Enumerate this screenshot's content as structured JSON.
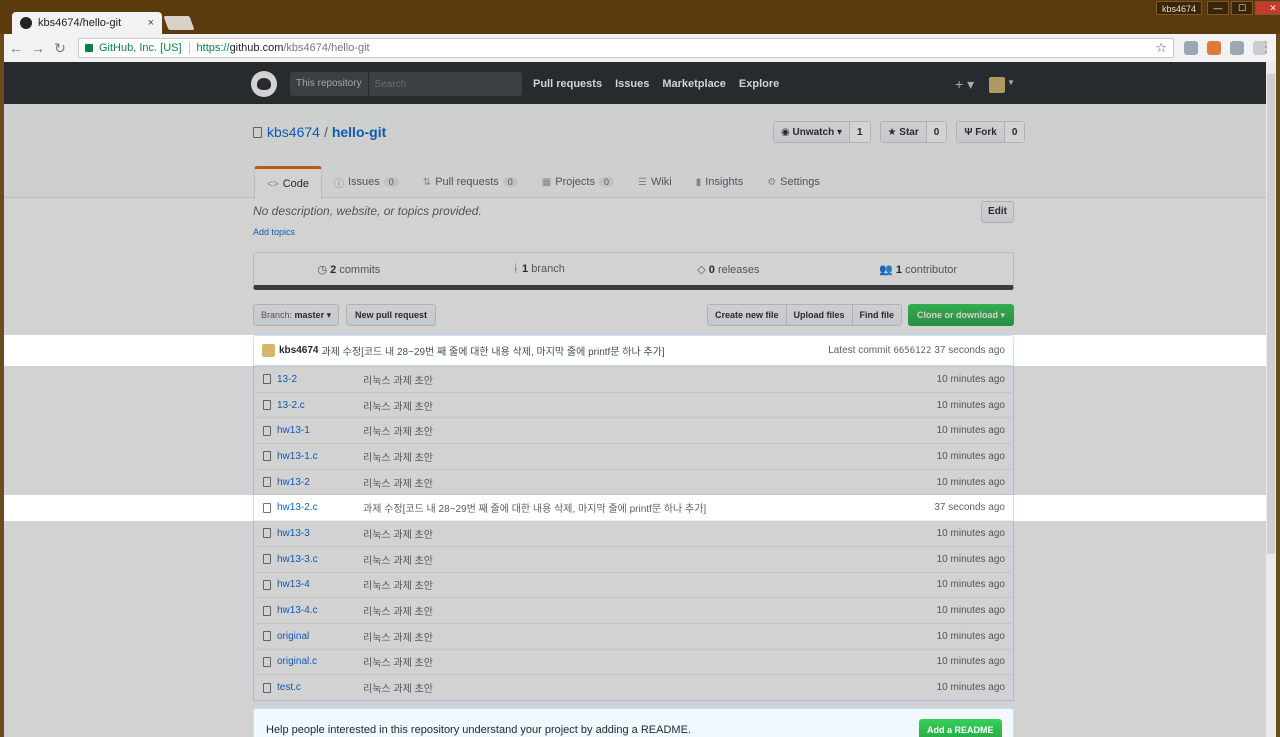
{
  "browser": {
    "tab_title": "kbs4674/hello-git",
    "tab_close": "×",
    "window_user": "kbs4674",
    "secure_label": "GitHub, Inc. [US]",
    "url_proto": "https://",
    "url_host": "github.com",
    "url_path": "/kbs4674/hello-git",
    "window_buttons": [
      "—",
      "☐",
      "✕"
    ]
  },
  "header": {
    "search_scope": "This repository",
    "search_placeholder": "Search",
    "nav": [
      "Pull requests",
      "Issues",
      "Marketplace",
      "Explore"
    ],
    "plus": "+ ▾"
  },
  "repo": {
    "owner": "kbs4674",
    "name": "hello-git",
    "watch_label": "Unwatch ▾",
    "watch_count": "1",
    "star_label": "Star",
    "star_count": "0",
    "fork_label": "Fork",
    "fork_count": "0",
    "tabs": [
      {
        "label": "Code",
        "icon": "<>",
        "count": null
      },
      {
        "label": "Issues",
        "icon": "ⓘ",
        "count": "0"
      },
      {
        "label": "Pull requests",
        "icon": "⇅",
        "count": "0"
      },
      {
        "label": "Projects",
        "icon": "▦",
        "count": "0"
      },
      {
        "label": "Wiki",
        "icon": "☰",
        "count": null
      },
      {
        "label": "Insights",
        "icon": "▮",
        "count": null
      },
      {
        "label": "Settings",
        "icon": "⚙",
        "count": null
      }
    ],
    "description": "No description, website, or topics provided.",
    "add_topics": "Add topics",
    "edit_label": "Edit"
  },
  "summary": {
    "commits_num": "2",
    "commits_label": "commits",
    "branch_num": "1",
    "branch_label": "branch",
    "releases_num": "0",
    "releases_label": "releases",
    "contrib_num": "1",
    "contrib_label": "contributor"
  },
  "filenav": {
    "branch_prefix": "Branch:",
    "branch_name": "master ▾",
    "new_pr": "New pull request",
    "create_file": "Create new file",
    "upload": "Upload files",
    "find": "Find file",
    "clone": "Clone or download ▾"
  },
  "commit": {
    "author": "kbs4674",
    "message": "과제 수정[코드 내 28~29번 째 줄에 대한 내용 삭제, 마지막 줄에 printf문 하나 추가]",
    "latest_label": "Latest commit",
    "sha": "6656122",
    "age": "37 seconds ago"
  },
  "files": [
    {
      "name": "13-2",
      "message": "리눅스 과제 초안",
      "age": "10 minutes ago"
    },
    {
      "name": "13-2.c",
      "message": "리눅스 과제 초안",
      "age": "10 minutes ago"
    },
    {
      "name": "hw13-1",
      "message": "리눅스 과제 초안",
      "age": "10 minutes ago"
    },
    {
      "name": "hw13-1.c",
      "message": "리눅스 과제 초안",
      "age": "10 minutes ago"
    },
    {
      "name": "hw13-2",
      "message": "리눅스 과제 초안",
      "age": "10 minutes ago"
    },
    {
      "name": "hw13-2.c",
      "message": "과제 수정[코드 내 28~29번 째 줄에 대한 내용 삭제, 마지막 줄에 printf문 하나 추가]",
      "age": "37 seconds ago"
    },
    {
      "name": "hw13-3",
      "message": "리눅스 과제 초안",
      "age": "10 minutes ago"
    },
    {
      "name": "hw13-3.c",
      "message": "리눅스 과제 초안",
      "age": "10 minutes ago"
    },
    {
      "name": "hw13-4",
      "message": "리눅스 과제 초안",
      "age": "10 minutes ago"
    },
    {
      "name": "hw13-4.c",
      "message": "리눅스 과제 초안",
      "age": "10 minutes ago"
    },
    {
      "name": "original",
      "message": "리눅스 과제 초안",
      "age": "10 minutes ago"
    },
    {
      "name": "original.c",
      "message": "리눅스 과제 초안",
      "age": "10 minutes ago"
    },
    {
      "name": "test.c",
      "message": "리눅스 과제 초안",
      "age": "10 minutes ago"
    }
  ],
  "readme": {
    "text": "Help people interested in this repository understand your project by adding a README.",
    "button": "Add a README"
  },
  "colors": {
    "link": "#0366d6",
    "header_bg": "#24292e",
    "accent_tab": "#e36209",
    "green": "#28a745"
  }
}
